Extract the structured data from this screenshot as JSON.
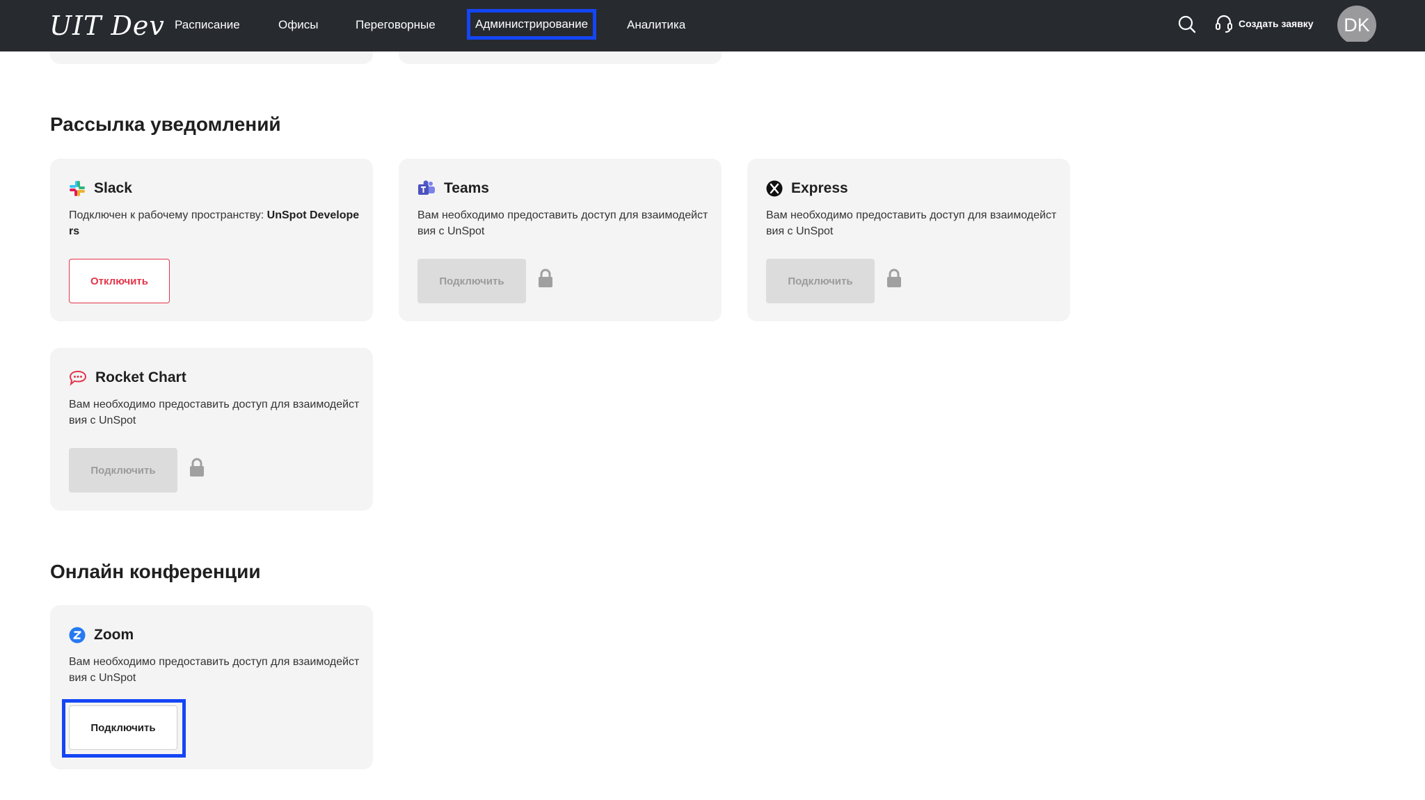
{
  "header": {
    "logo": "UIT Dev",
    "nav": [
      {
        "label": "Расписание"
      },
      {
        "label": "Офисы"
      },
      {
        "label": "Переговорные"
      },
      {
        "label": "Администрирование"
      },
      {
        "label": "Аналитика"
      }
    ],
    "support_label": "Создать заявку",
    "avatar_initials": "DK"
  },
  "notifications": {
    "title": "Рассылка уведомлений",
    "slack": {
      "name": "Slack",
      "text": "Подключен к рабочему пространству: ",
      "workspace": "UnSpot Developers",
      "button": "Отключить"
    },
    "teams": {
      "name": "Teams",
      "text": "Вам необходимо предоставить доступ для взаимодействия с UnSpot",
      "button": "Подключить"
    },
    "express": {
      "name": "Express",
      "text": "Вам необходимо предоставить доступ для взаимодействия с UnSpot",
      "button": "Подключить"
    },
    "rocket": {
      "name": "Rocket Chart",
      "text": "Вам необходимо предоставить доступ для взаимодействия с UnSpot",
      "button": "Подключить"
    }
  },
  "conferences": {
    "title": "Онлайн конференции",
    "zoom": {
      "name": "Zoom",
      "text": "Вам необходимо предоставить доступ для взаимодействия с UnSpot",
      "button": "Подключить"
    }
  },
  "colors": {
    "header_bg": "#272a2f",
    "highlight": "#1446f5",
    "danger": "#e3344a",
    "card_bg": "#f4f4f4"
  }
}
